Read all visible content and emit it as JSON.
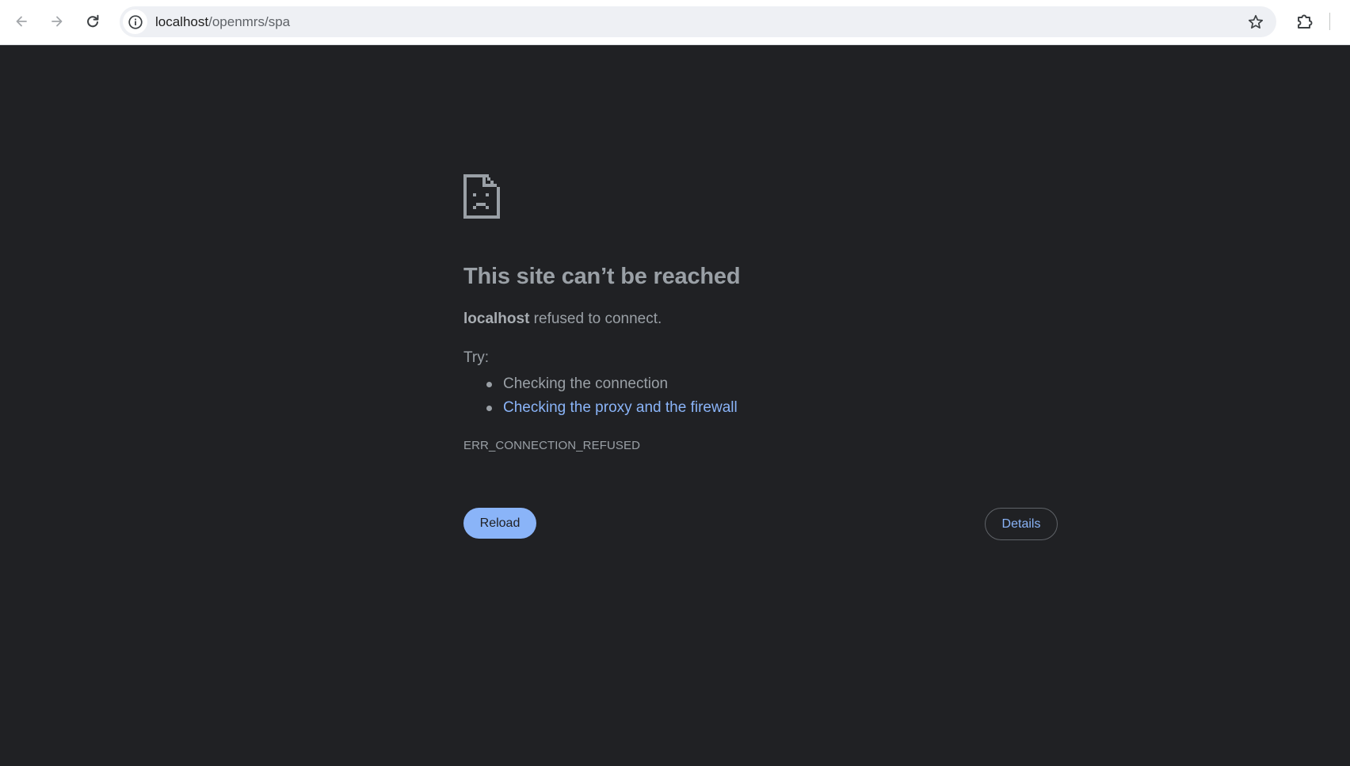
{
  "browser": {
    "url": {
      "host": "localhost",
      "path": "/openmrs/spa"
    },
    "icons": {
      "back": "arrow-left-icon",
      "forward": "arrow-right-icon",
      "reload": "reload-icon",
      "site_info": "info-circle-icon",
      "bookmark": "star-icon",
      "extensions": "puzzle-piece-icon"
    }
  },
  "error_page": {
    "icon": "sad-document-icon",
    "title": "This site can’t be reached",
    "host": "localhost",
    "message": " refused to connect.",
    "try_label": "Try:",
    "suggestions": [
      "Checking the connection",
      "Checking the proxy and the firewall"
    ],
    "error_code": "ERR_CONNECTION_REFUSED",
    "reload_label": "Reload",
    "details_label": "Details"
  },
  "colors": {
    "page_background": "#202124",
    "text": "#9aa0a6",
    "link": "#8ab4f8",
    "primary_button": "#8ab4f8",
    "toolbar_background": "#ffffff",
    "omnibox_background": "#eef0f4"
  }
}
